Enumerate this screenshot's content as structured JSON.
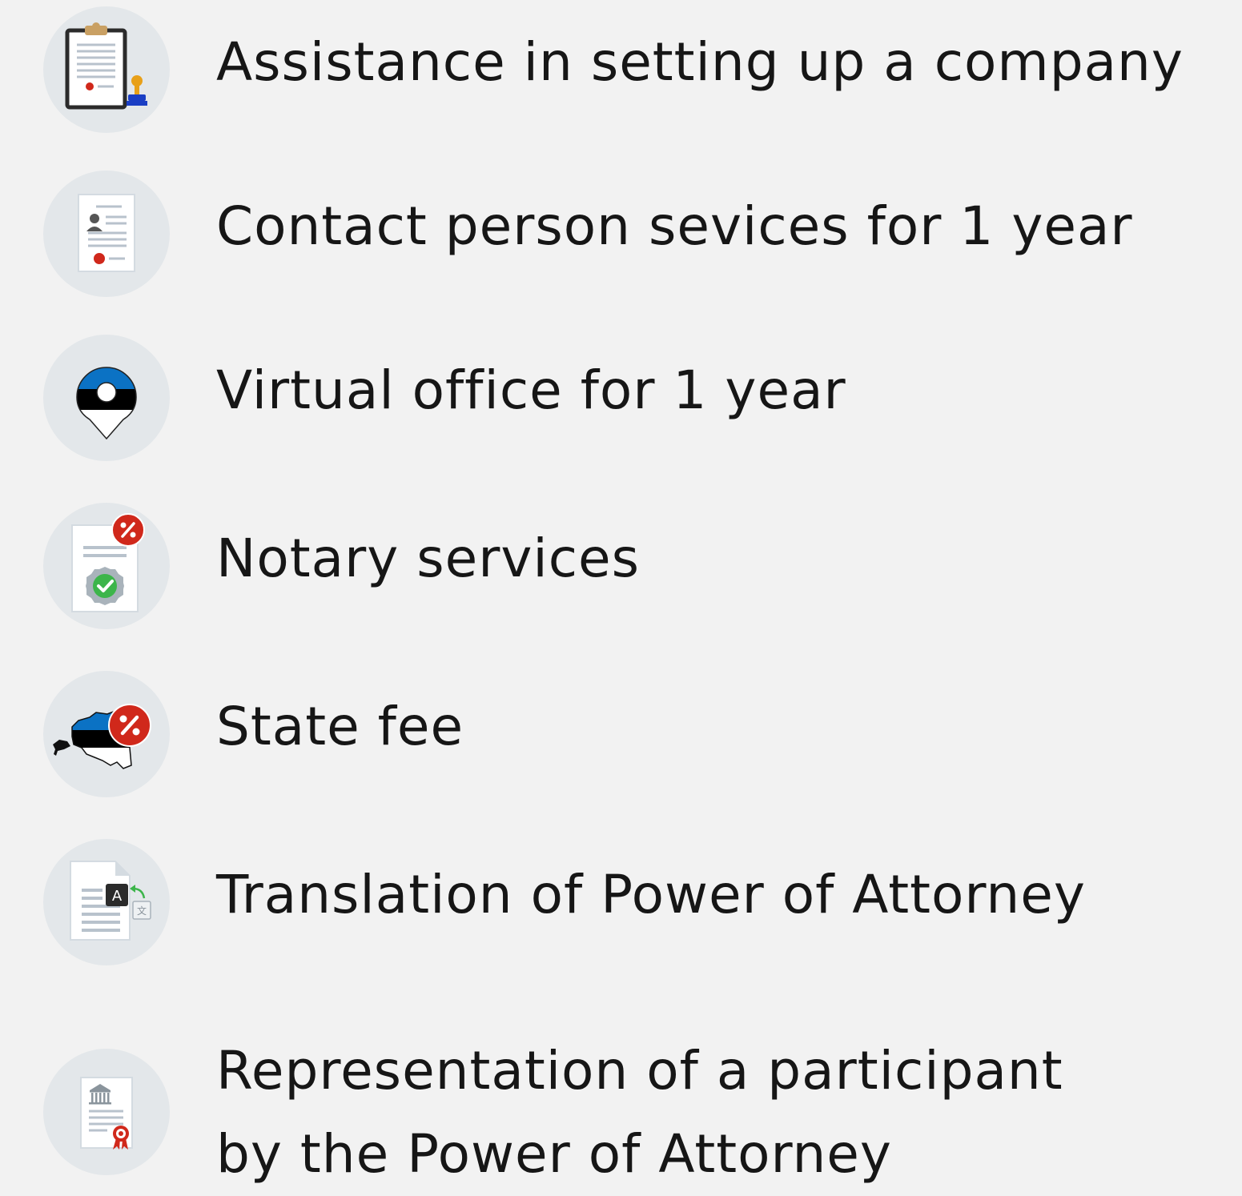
{
  "services": {
    "items": [
      {
        "label": "Assistance in setting up a company",
        "icon": "clipboard-stamp-icon"
      },
      {
        "label": "Contact person sevices for 1 year",
        "icon": "contact-card-icon"
      },
      {
        "label": "Virtual office for 1 year",
        "icon": "estonia-location-pin-icon"
      },
      {
        "label": "Notary services",
        "icon": "certified-document-discount-icon"
      },
      {
        "label": "State fee",
        "icon": "estonia-map-discount-icon"
      },
      {
        "label": "Translation of Power of Attorney",
        "icon": "document-translation-icon"
      },
      {
        "label": "Representation of a participant\nby the Power of Attorney",
        "icon": "official-document-seal-icon"
      }
    ]
  },
  "colors": {
    "background": "#f2f2f2",
    "icon_circle": "#e3e7ea",
    "text": "#161616",
    "estonia_blue": "#0b72c4",
    "estonia_black": "#000000",
    "discount_red": "#d0281b",
    "check_green": "#3cb54a",
    "stamp_orange": "#e8a019"
  }
}
